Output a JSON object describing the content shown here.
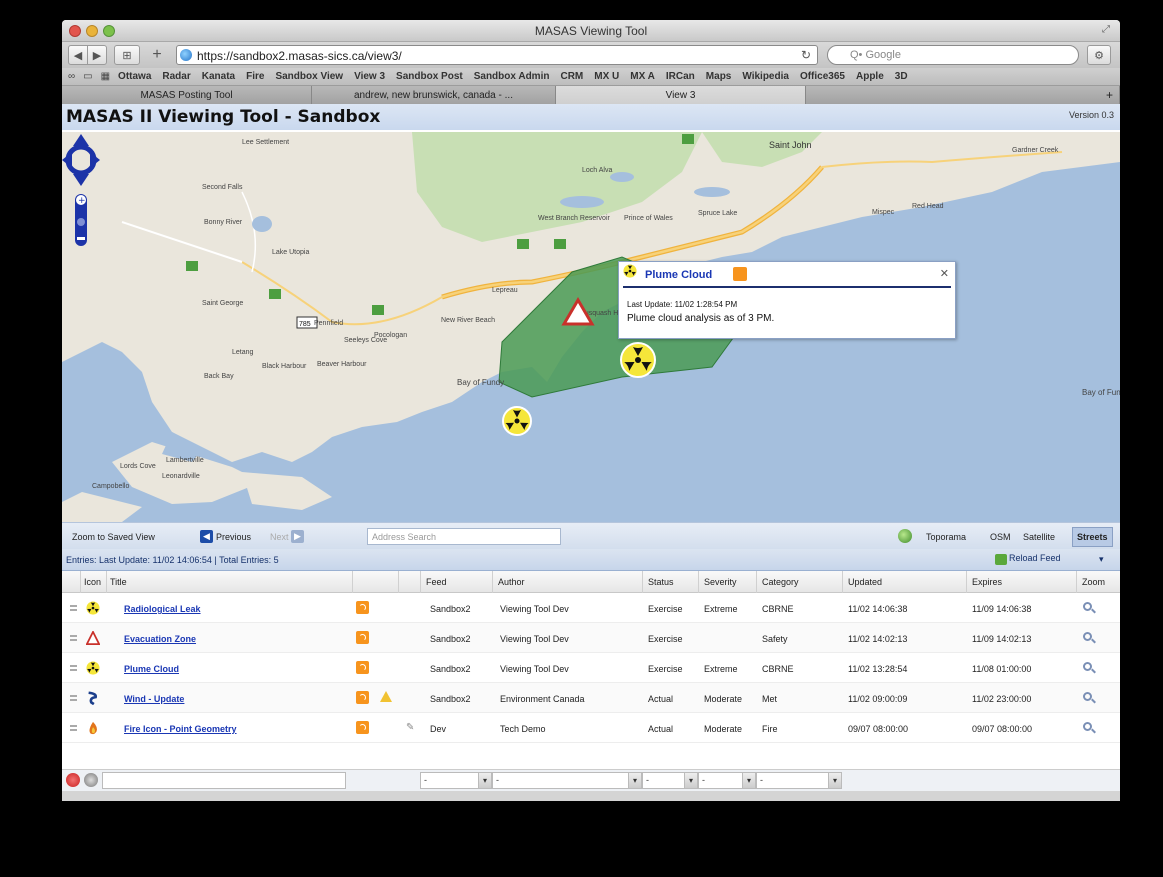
{
  "window": {
    "title": "MASAS Viewing Tool",
    "url": "https://sandbox2.masas-sics.ca/view3/",
    "search_placeholder": "Q• Google"
  },
  "bookmarks": [
    "Ottawa",
    "Radar",
    "Kanata",
    "Fire",
    "Sandbox View",
    "View 3",
    "Sandbox Post",
    "Sandbox Admin",
    "CRM",
    "MX U",
    "MX A",
    "IRCan",
    "Maps",
    "Wikipedia",
    "Office365",
    "Apple",
    "3D"
  ],
  "tabs": [
    "MASAS Posting Tool",
    "andrew, new brunswick, canada - ...",
    "View 3",
    "+"
  ],
  "page": {
    "title": "MASAS II Viewing Tool - Sandbox",
    "version": "Version 0.3"
  },
  "map": {
    "labels": {
      "saint_john": "Saint John",
      "bay_of_fundy_center": "Bay of Fundy",
      "bay_of_fundy_right": "Bay of Fundy",
      "lake_utopia": "Lake Utopia",
      "st_george": "Saint George",
      "pennfield": "Pennfield",
      "black_harbour": "Black Harbour",
      "back_bay": "Back Bay",
      "letang": "Letang",
      "beaver_harbour": "Beaver Harbour",
      "seeleys_cove": "Seeleys Cove",
      "pocologan": "Pocologan",
      "new_river_beach": "New River Beach",
      "lepreau": "Lepreau",
      "musquash": "Musquash Harbour",
      "west_branch": "West Branch Reservoir",
      "loch_alva": "Loch Alva",
      "prince_of_wales": "Prince of Wales",
      "spruce_lake": "Spruce Lake",
      "gardner_creek": "Gardner Creek",
      "mispec": "Mispec",
      "red_head": "Red Head",
      "hwy_785": "785",
      "second_falls": "Second Falls",
      "bonny_river": "Bonny River",
      "lake_settlement": "Lee Settlement",
      "campobello": "Campobello",
      "lord_cove": "Lords Cove",
      "lambertville": "Lambertville",
      "leonardville": "Leonardville"
    },
    "popup": {
      "title": "Plume Cloud",
      "last_update": "Last Update: 11/02 1:28:54 PM",
      "description": "Plume cloud analysis as of 3 PM."
    },
    "footer": {
      "zoom_saved": "Zoom to Saved View",
      "previous": "Previous",
      "next": "Next",
      "address_placeholder": "Address Search",
      "layers": [
        "Toporama",
        "OSM",
        "Satellite",
        "Streets"
      ],
      "active_layer": "Streets"
    }
  },
  "grid": {
    "status": "Entries:  Last Update:  11/02 14:06:54  |  Total Entries:  5",
    "reload_label": "Reload Feed",
    "columns": [
      "Icon",
      "Title",
      "Feed",
      "Author",
      "Status",
      "Severity",
      "Category",
      "Updated",
      "Expires",
      "Zoom"
    ],
    "rows": [
      {
        "icon": "radiation-icon",
        "title": "Radiological Leak",
        "feed": "Sandbox2",
        "author": "Viewing Tool Dev",
        "status": "Exercise",
        "severity": "Extreme",
        "category": "CBRNE",
        "updated": "11/02 14:06:38",
        "expires": "11/09 14:06:38",
        "warn": false,
        "edit": false
      },
      {
        "icon": "evacuation-icon",
        "title": "Evacuation Zone",
        "feed": "Sandbox2",
        "author": "Viewing Tool Dev",
        "status": "Exercise",
        "severity": "",
        "category": "Safety",
        "updated": "11/02 14:02:13",
        "expires": "11/09 14:02:13",
        "warn": false,
        "edit": false
      },
      {
        "icon": "radiation-icon",
        "title": "Plume Cloud",
        "feed": "Sandbox2",
        "author": "Viewing Tool Dev",
        "status": "Exercise",
        "severity": "Extreme",
        "category": "CBRNE",
        "updated": "11/02 13:28:54",
        "expires": "11/08 01:00:00",
        "warn": false,
        "edit": false
      },
      {
        "icon": "wind-icon",
        "title": "Wind - Update",
        "feed": "Sandbox2",
        "author": "Environment Canada",
        "status": "Actual",
        "severity": "Moderate",
        "category": "Met",
        "updated": "11/02 09:00:09",
        "expires": "11/02 23:00:00",
        "warn": true,
        "edit": false
      },
      {
        "icon": "fire-icon",
        "title": "Fire Icon - Point Geometry",
        "feed": "Dev",
        "author": "Tech Demo",
        "status": "Actual",
        "severity": "Moderate",
        "category": "Fire",
        "updated": "09/07 08:00:00",
        "expires": "09/07 08:00:00",
        "warn": false,
        "edit": true
      }
    ],
    "filters": [
      "-",
      "-",
      "-",
      "-",
      "-"
    ]
  },
  "colors": {
    "water": "#a5bfdd",
    "land": "#eae6dc",
    "forest": "#c8dfb4",
    "plume": "#4a9a55",
    "link": "#1a37b4"
  }
}
